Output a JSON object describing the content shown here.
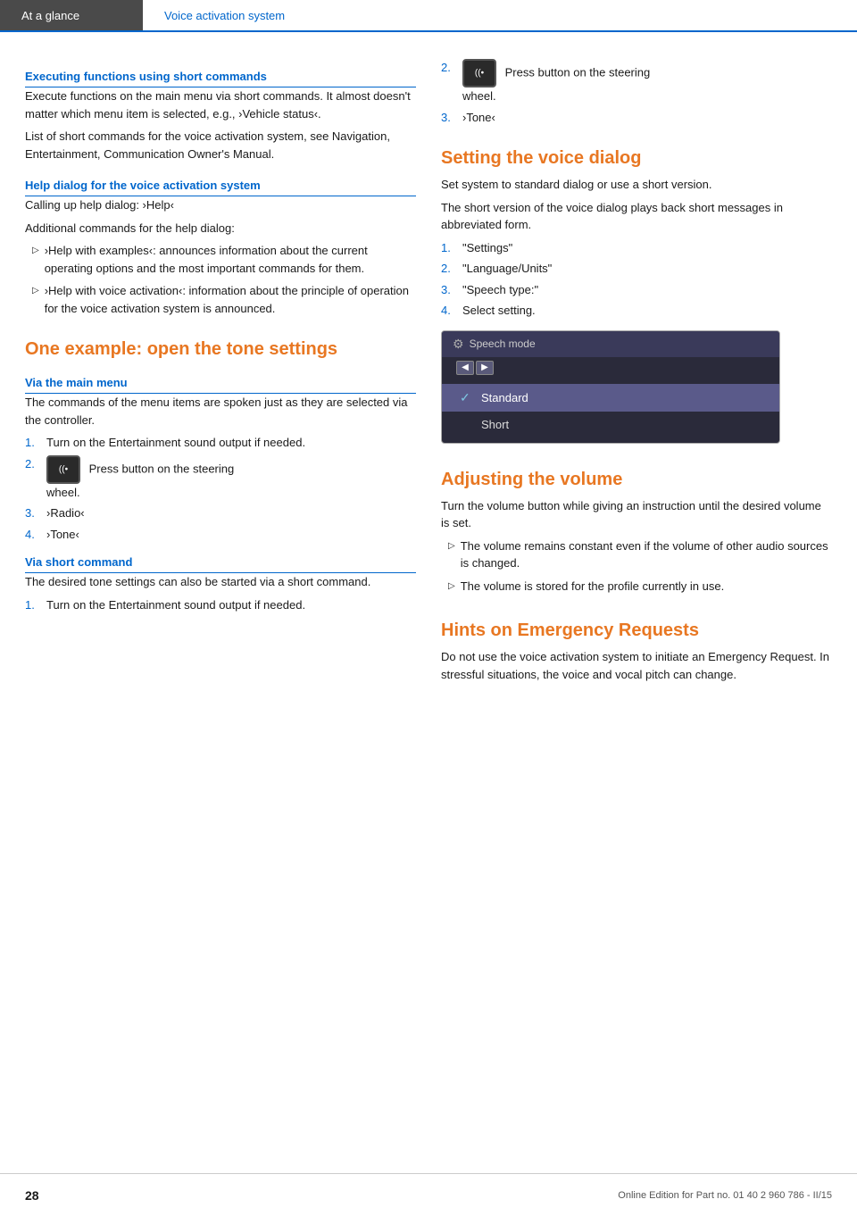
{
  "header": {
    "left_label": "At a glance",
    "right_label": "Voice activation system"
  },
  "left_column": {
    "section1": {
      "heading": "Executing functions using short commands",
      "para1": "Execute functions on the main menu via short commands. It almost doesn't matter which menu item is selected, e.g., ›Vehicle status‹.",
      "para2": "List of short commands for the voice activation system, see Navigation, Entertainment, Communication Owner's Manual."
    },
    "section2": {
      "heading": "Help dialog for the voice activation system",
      "para1": "Calling up help dialog: ›Help‹",
      "para2": "Additional commands for the help dialog:",
      "bullets": [
        "›Help with examples‹: announces information about the current operating options and the most important commands for them.",
        "›Help with voice activation‹: information about the principle of operation for the voice activation system is announced."
      ]
    },
    "section3": {
      "heading": "One example: open the tone settings",
      "sub_heading1": "Via the main menu",
      "para1": "The commands of the menu items are spoken just as they are selected via the controller.",
      "steps_main": [
        {
          "num": "1.",
          "text": "Turn on the Entertainment sound output if needed."
        },
        {
          "num": "2.",
          "icon": true,
          "text_before": "Press button on the steering",
          "text_after": "wheel."
        },
        {
          "num": "3.",
          "text": "›Radio‹"
        },
        {
          "num": "4.",
          "text": "›Tone‹"
        }
      ],
      "sub_heading2": "Via short command",
      "para2": "The desired tone settings can also be started via a short command.",
      "steps_short": [
        {
          "num": "1.",
          "text": "Turn on the Entertainment sound output if needed."
        }
      ]
    }
  },
  "right_column": {
    "step2_right": {
      "num": "2.",
      "icon": true,
      "text_before": "Press button on the steering",
      "text_after": "wheel."
    },
    "step3_right": {
      "num": "3.",
      "text": "›Tone‹"
    },
    "section_voice_dialog": {
      "heading": "Setting the voice dialog",
      "para1": "Set system to standard dialog or use a short version.",
      "para2": "The short version of the voice dialog plays back short messages in abbreviated form.",
      "steps": [
        {
          "num": "1.",
          "text": "\"Settings\""
        },
        {
          "num": "2.",
          "text": "\"Language/Units\""
        },
        {
          "num": "3.",
          "text": "\"Speech type:\""
        },
        {
          "num": "4.",
          "text": "Select setting."
        }
      ],
      "speech_mode_box": {
        "title_icon": "⚙",
        "title": "Speech mode",
        "options": [
          {
            "label": "Standard",
            "selected": true
          },
          {
            "label": "Short",
            "selected": false
          }
        ]
      }
    },
    "section_volume": {
      "heading": "Adjusting the volume",
      "para1": "Turn the volume button while giving an instruction until the desired volume is set.",
      "bullets": [
        "The volume remains constant even if the volume of other audio sources is changed.",
        "The volume is stored for the profile currently in use."
      ]
    },
    "section_emergency": {
      "heading": "Hints on Emergency Requests",
      "para1": "Do not use the voice activation system to initiate an Emergency Request. In stressful situations, the voice and vocal pitch can change."
    }
  },
  "footer": {
    "page_number": "28",
    "info": "Online Edition for Part no. 01 40 2 960 786 - II/15"
  }
}
